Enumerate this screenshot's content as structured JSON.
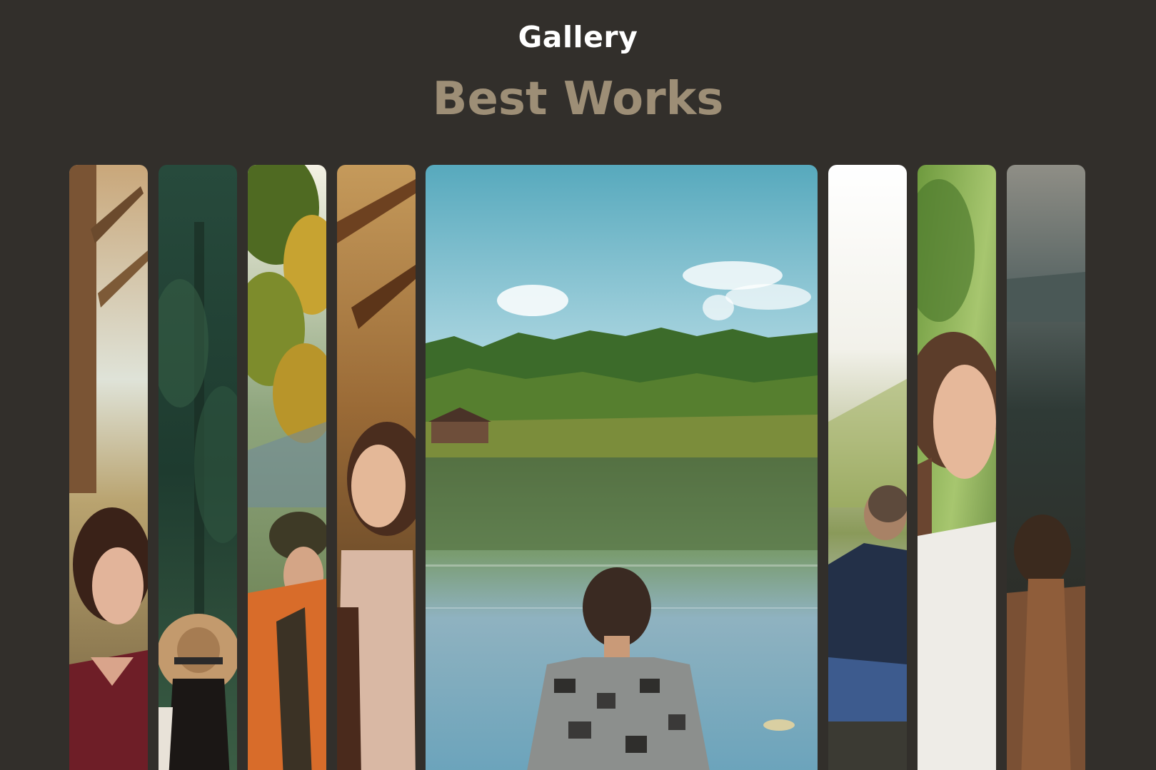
{
  "header": {
    "eyebrow": "Gallery",
    "title": "Best Works"
  },
  "colors": {
    "background": "#322f2b",
    "eyebrow": "#ffffff",
    "title_accent": "#9d8e76"
  },
  "gallery": {
    "expanded_index": 4,
    "items": [
      "photo-woman-red-sweater-trees",
      "photo-woman-straw-hat-forest",
      "photo-man-beanie-orange-jacket",
      "photo-woman-turtleneck-autumn",
      "photo-boy-lake-reflection",
      "photo-man-sitting-by-river",
      "photo-smiling-woman-white-top",
      "photo-woman-dusk-mountains"
    ]
  }
}
